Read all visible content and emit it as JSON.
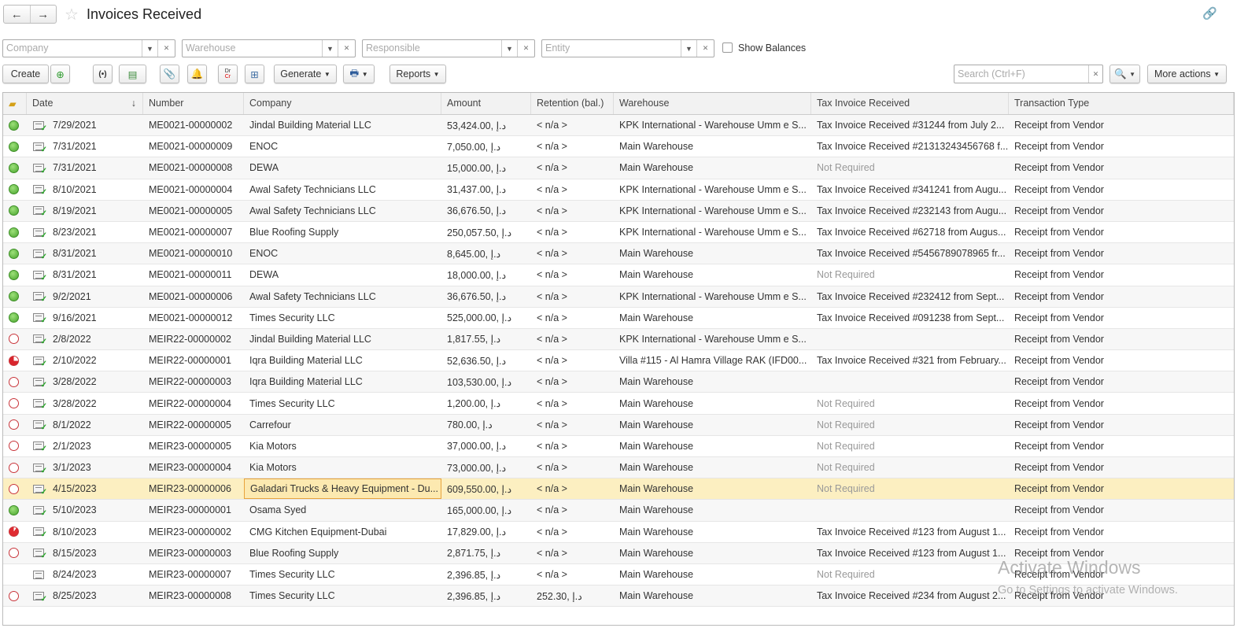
{
  "header": {
    "title": "Invoices Received",
    "back": "←",
    "forward": "→"
  },
  "filters": [
    {
      "placeholder": "Company"
    },
    {
      "placeholder": "Warehouse"
    },
    {
      "placeholder": "Responsible"
    },
    {
      "placeholder": "Entity"
    }
  ],
  "show_balances_label": "Show Balances",
  "toolbar": {
    "create": "Create",
    "generate": "Generate",
    "reports": "Reports",
    "more_actions": "More actions",
    "search_placeholder": "Search (Ctrl+F)",
    "drcr_top": "Dr",
    "drcr_bottom": "Cr"
  },
  "columns": [
    "Date",
    "Number",
    "Company",
    "Amount",
    "Retention (bal.)",
    "Warehouse",
    "Tax Invoice Received",
    "Transaction Type"
  ],
  "rows": [
    {
      "status": "green",
      "posted": true,
      "date": "7/29/2021",
      "number": "ME0021-00000002",
      "company": "Jindal Building Material LLC",
      "amount": "53,424.00, د.إ",
      "retention": "< n/a >",
      "warehouse": "KPK International - Warehouse Umm e S...",
      "tax": "Tax Invoice Received #31244 from July 2...",
      "type": "Receipt from Vendor"
    },
    {
      "status": "green",
      "posted": true,
      "date": "7/31/2021",
      "number": "ME0021-00000009",
      "company": "ENOC",
      "amount": "7,050.00, د.إ",
      "retention": "< n/a >",
      "warehouse": "Main Warehouse",
      "tax": "Tax Invoice Received #21313243456768 f...",
      "type": "Receipt from Vendor"
    },
    {
      "status": "green",
      "posted": true,
      "date": "7/31/2021",
      "number": "ME0021-00000008",
      "company": "DEWA",
      "amount": "15,000.00, د.إ",
      "retention": "< n/a >",
      "warehouse": "Main Warehouse",
      "tax": "Not Required",
      "type": "Receipt from Vendor"
    },
    {
      "status": "green",
      "posted": true,
      "date": "8/10/2021",
      "number": "ME0021-00000004",
      "company": "Awal Safety Technicians LLC",
      "amount": "31,437.00, د.إ",
      "retention": "< n/a >",
      "warehouse": "KPK International - Warehouse Umm e S...",
      "tax": "Tax Invoice Received #341241 from Augu...",
      "type": "Receipt from Vendor"
    },
    {
      "status": "green",
      "posted": true,
      "date": "8/19/2021",
      "number": "ME0021-00000005",
      "company": "Awal Safety Technicians LLC",
      "amount": "36,676.50, د.إ",
      "retention": "< n/a >",
      "warehouse": "KPK International - Warehouse Umm e S...",
      "tax": "Tax Invoice Received #232143 from Augu...",
      "type": "Receipt from Vendor"
    },
    {
      "status": "green",
      "posted": true,
      "date": "8/23/2021",
      "number": "ME0021-00000007",
      "company": "Blue Roofing Supply",
      "amount": "250,057.50, د.إ",
      "retention": "< n/a >",
      "warehouse": "KPK International - Warehouse Umm e S...",
      "tax": "Tax Invoice Received #62718 from Augus...",
      "type": "Receipt from Vendor"
    },
    {
      "status": "green",
      "posted": true,
      "date": "8/31/2021",
      "number": "ME0021-00000010",
      "company": "ENOC",
      "amount": "8,645.00, د.إ",
      "retention": "< n/a >",
      "warehouse": "Main Warehouse",
      "tax": "Tax Invoice Received #5456789078965 fr...",
      "type": "Receipt from Vendor"
    },
    {
      "status": "green",
      "posted": true,
      "date": "8/31/2021",
      "number": "ME0021-00000011",
      "company": "DEWA",
      "amount": "18,000.00, د.إ",
      "retention": "< n/a >",
      "warehouse": "Main Warehouse",
      "tax": "Not Required",
      "type": "Receipt from Vendor"
    },
    {
      "status": "green",
      "posted": true,
      "date": "9/2/2021",
      "number": "ME0021-00000006",
      "company": "Awal Safety Technicians LLC",
      "amount": "36,676.50, د.إ",
      "retention": "< n/a >",
      "warehouse": "KPK International - Warehouse Umm e S...",
      "tax": "Tax Invoice Received #232412 from Sept...",
      "type": "Receipt from Vendor"
    },
    {
      "status": "green",
      "posted": true,
      "date": "9/16/2021",
      "number": "ME0021-00000012",
      "company": "Times Security LLC",
      "amount": "525,000.00, د.إ",
      "retention": "< n/a >",
      "warehouse": "Main Warehouse",
      "tax": "Tax Invoice Received #091238 from Sept...",
      "type": "Receipt from Vendor"
    },
    {
      "status": "open",
      "posted": true,
      "date": "2/8/2022",
      "number": "MEIR22-00000002",
      "company": "Jindal Building Material LLC",
      "amount": "1,817.55, د.إ",
      "retention": "< n/a >",
      "warehouse": "KPK International - Warehouse Umm e S...",
      "tax": "",
      "type": "Receipt from Vendor"
    },
    {
      "status": "pie",
      "posted": true,
      "date": "2/10/2022",
      "number": "MEIR22-00000001",
      "company": "Iqra Building Material LLC",
      "amount": "52,636.50, د.إ",
      "retention": "< n/a >",
      "warehouse": "Villa #115 - Al Hamra Village RAK (IFD00...",
      "tax": "Tax Invoice Received #321 from February...",
      "type": "Receipt from Vendor"
    },
    {
      "status": "open",
      "posted": true,
      "date": "3/28/2022",
      "number": "MEIR22-00000003",
      "company": "Iqra Building Material LLC",
      "amount": "103,530.00, د.إ",
      "retention": "< n/a >",
      "warehouse": "Main Warehouse",
      "tax": "",
      "type": "Receipt from Vendor"
    },
    {
      "status": "open",
      "posted": true,
      "date": "3/28/2022",
      "number": "MEIR22-00000004",
      "company": "Times Security LLC",
      "amount": "1,200.00, د.إ",
      "retention": "< n/a >",
      "warehouse": "Main Warehouse",
      "tax": "Not Required",
      "type": "Receipt from Vendor"
    },
    {
      "status": "open",
      "posted": true,
      "date": "8/1/2022",
      "number": "MEIR22-00000005",
      "company": "Carrefour",
      "amount": "780.00, د.إ",
      "retention": "< n/a >",
      "warehouse": "Main Warehouse",
      "tax": "Not Required",
      "type": "Receipt from Vendor"
    },
    {
      "status": "open",
      "posted": true,
      "date": "2/1/2023",
      "number": "MEIR23-00000005",
      "company": "Kia Motors",
      "amount": "37,000.00, د.إ",
      "retention": "< n/a >",
      "warehouse": "Main Warehouse",
      "tax": "Not Required",
      "type": "Receipt from Vendor"
    },
    {
      "status": "open",
      "posted": true,
      "date": "3/1/2023",
      "number": "MEIR23-00000004",
      "company": "Kia Motors",
      "amount": "73,000.00, د.إ",
      "retention": "< n/a >",
      "warehouse": "Main Warehouse",
      "tax": "Not Required",
      "type": "Receipt from Vendor"
    },
    {
      "status": "open",
      "posted": true,
      "selected": true,
      "date": "4/15/2023",
      "number": "MEIR23-00000006",
      "company": "Galadari Trucks & Heavy Equipment - Du...",
      "amount": "609,550.00, د.إ",
      "retention": "< n/a >",
      "warehouse": "Main Warehouse",
      "tax": "Not Required",
      "type": "Receipt from Vendor"
    },
    {
      "status": "green",
      "posted": true,
      "date": "5/10/2023",
      "number": "MEIR23-00000001",
      "company": "Osama Syed",
      "amount": "165,000.00, د.إ",
      "retention": "< n/a >",
      "warehouse": "Main Warehouse",
      "tax": "",
      "type": "Receipt from Vendor"
    },
    {
      "status": "pie2",
      "posted": true,
      "date": "8/10/2023",
      "number": "MEIR23-00000002",
      "company": "CMG Kitchen Equipment-Dubai",
      "amount": "17,829.00, د.إ",
      "retention": "< n/a >",
      "warehouse": "Main Warehouse",
      "tax": "Tax Invoice Received #123 from August 1...",
      "type": "Receipt from Vendor"
    },
    {
      "status": "open",
      "posted": true,
      "date": "8/15/2023",
      "number": "MEIR23-00000003",
      "company": "Blue Roofing Supply",
      "amount": "2,871.75, د.إ",
      "retention": "< n/a >",
      "warehouse": "Main Warehouse",
      "tax": "Tax Invoice Received #123 from August 1...",
      "type": "Receipt from Vendor"
    },
    {
      "status": "none",
      "posted": false,
      "date": "8/24/2023",
      "number": "MEIR23-00000007",
      "company": "Times Security LLC",
      "amount": "2,396.85, د.إ",
      "retention": "< n/a >",
      "warehouse": "Main Warehouse",
      "tax": "Not Required",
      "type": "Receipt from Vendor"
    },
    {
      "status": "open",
      "posted": true,
      "date": "8/25/2023",
      "number": "MEIR23-00000008",
      "company": "Times Security LLC",
      "amount": "2,396.85, د.إ",
      "retention": "252.30, د.إ",
      "warehouse": "Main Warehouse",
      "tax": "Tax Invoice Received #234 from August 2...",
      "type": "Receipt from Vendor"
    }
  ],
  "watermark": {
    "line1": "Activate Windows",
    "line2": "Go to Settings to activate Windows."
  }
}
